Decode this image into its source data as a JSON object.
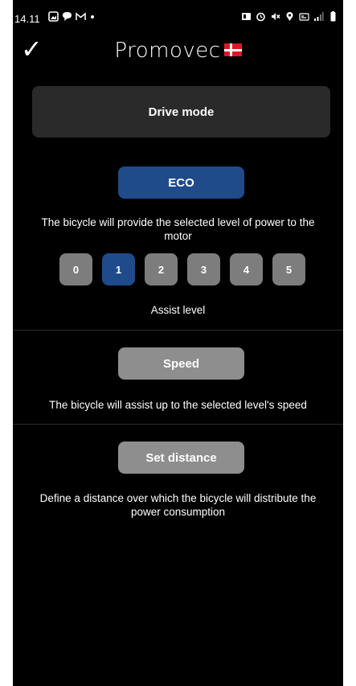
{
  "status_bar": {
    "time": "14.11"
  },
  "header": {
    "brand": "Promovec"
  },
  "drive_mode": {
    "title": "Drive mode"
  },
  "eco": {
    "label": "ECO",
    "description": "The bicycle will provide the selected level of power to the motor",
    "assist_levels": [
      "0",
      "1",
      "2",
      "3",
      "4",
      "5"
    ],
    "selected_level": "1",
    "assist_label": "Assist level"
  },
  "speed": {
    "label": "Speed",
    "description": "The bicycle will assist up to the selected level's speed"
  },
  "set_distance": {
    "label": "Set distance",
    "description": "Define a distance over which the bicycle will distribute the power consumption"
  },
  "colors": {
    "active": "#1f4b8b",
    "inactive": "#8e8e8e",
    "background": "#000000",
    "card": "#2a2a2a"
  }
}
